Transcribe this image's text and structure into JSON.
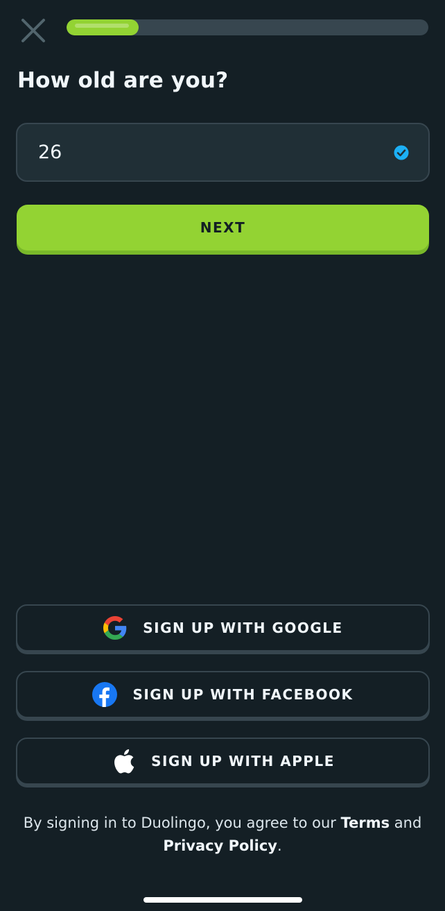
{
  "progress": {
    "fraction": 0.2
  },
  "title": "How old are you?",
  "age_input": {
    "value": "26"
  },
  "next_button": {
    "label": "NEXT"
  },
  "social": {
    "google_label": "SIGN UP WITH GOOGLE",
    "facebook_label": "SIGN UP WITH FACEBOOK",
    "apple_label": "SIGN UP WITH APPLE"
  },
  "legal": {
    "prefix": "By signing in to Duolingo, you agree to our ",
    "terms": "Terms",
    "middle": " and",
    "privacy": "Privacy Policy",
    "suffix": "."
  },
  "icons": {
    "close": "close-icon",
    "check": "check-circle-icon",
    "google": "google-icon",
    "facebook": "facebook-icon",
    "apple": "apple-icon"
  },
  "colors": {
    "background": "#141f25",
    "accent_green": "#93d333",
    "field_border": "#37464f",
    "check_blue": "#1cb0f6"
  }
}
